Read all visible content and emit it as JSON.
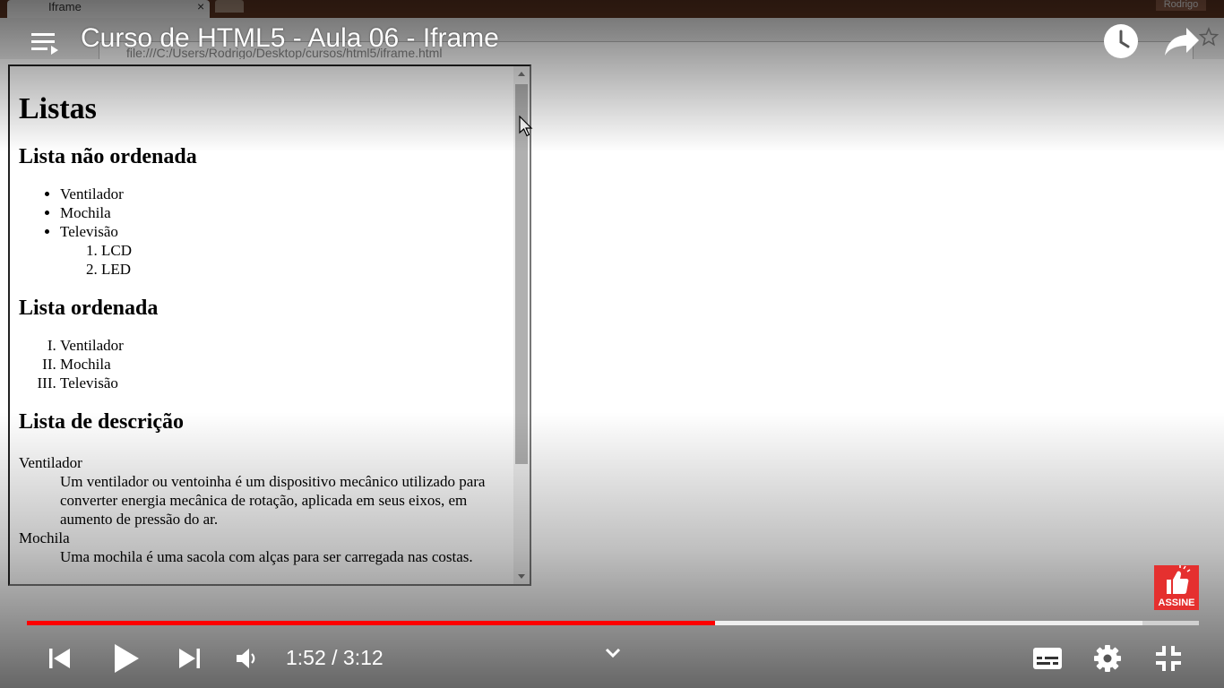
{
  "browser": {
    "tab_title": "Iframe",
    "tab_close": "×",
    "user_label": "Rodrigo",
    "address": "file:///C:/Users/Rodrigo/Desktop/cursos/html5/iframe.html"
  },
  "video": {
    "title": "Curso de HTML5 - Aula 06 - Iframe",
    "time_display": "1:52 / 3:12",
    "progress_played": 0.587,
    "progress_loaded": 0.952,
    "subscribe_badge": "ASSINE",
    "accent_color": "#ff0000"
  },
  "iframe_page": {
    "heading": "Listas",
    "unordered": {
      "heading": "Lista não ordenada",
      "items": [
        "Ventilador",
        "Mochila",
        "Televisão"
      ],
      "nested_items": [
        "LCD",
        "LED"
      ]
    },
    "ordered": {
      "heading": "Lista ordenada",
      "items": [
        "Ventilador",
        "Mochila",
        "Televisão"
      ]
    },
    "description": {
      "heading": "Lista de descrição",
      "term1": "Ventilador",
      "def1": "Um ventilador ou ventoinha é um dispositivo mecânico utilizado para converter energia mecânica de rotação, aplicada em seus eixos, em aumento de pressão do ar.",
      "term2": "Mochila",
      "def2": "Uma mochila é uma sacola com alças para ser carregada nas costas."
    }
  }
}
